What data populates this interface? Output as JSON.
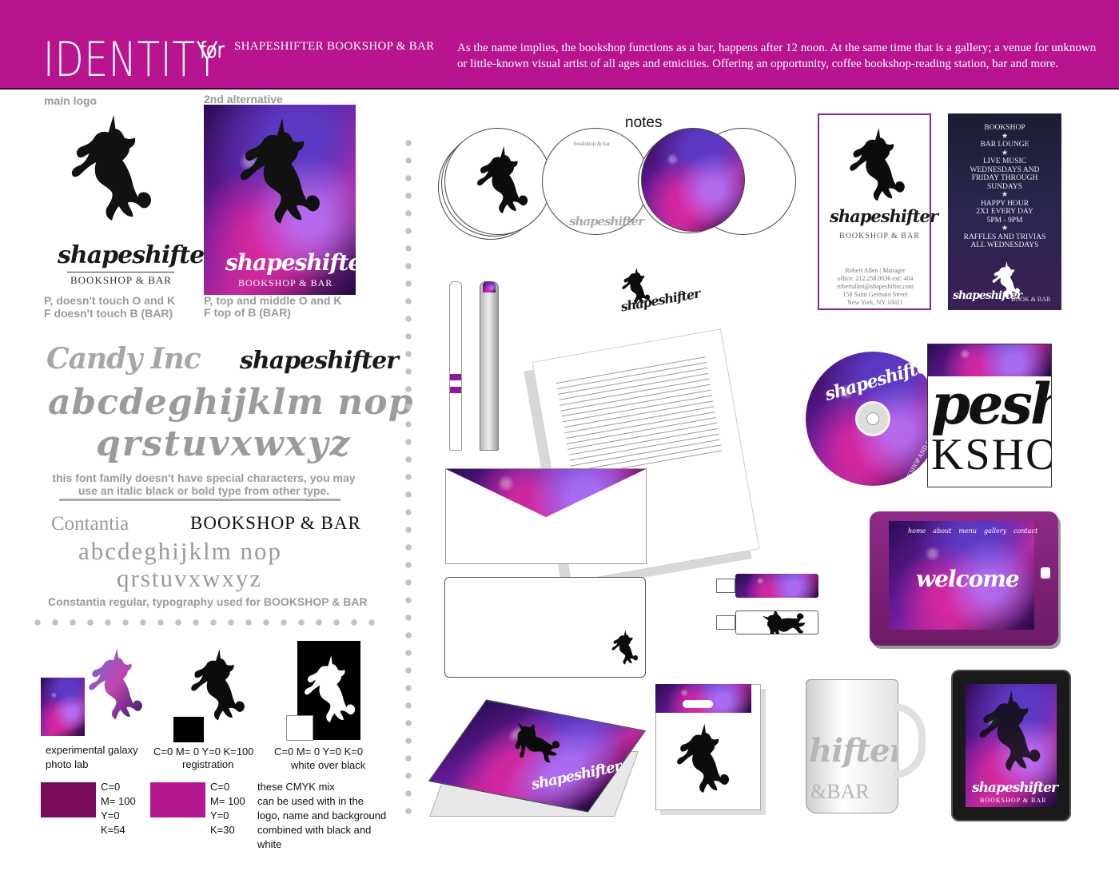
{
  "header": {
    "identity": "IDENTITY",
    "for": "for",
    "brand": "SHAPESHIFTER  BOOKSHOP & BAR",
    "description": "As the name implies, the bookshop functions as a bar, happens after 12 noon. At the same time that is a gallery; a venue for unknown or little-known visual artist of all ages and etnicities. Offering an opportunity, coffee bookshop-reading station, bar and more."
  },
  "logos": {
    "main_label": "main logo",
    "alt_label": "2nd alternative",
    "wordmark": "shapeshifter",
    "sub": "BOOKSHOP & BAR",
    "main_note_1": "P, doesn't touch O and K",
    "main_note_2": "F doesn't touch B (BAR)",
    "alt_note_1": "P, top and middle O and K",
    "alt_note_2": "F top of B (BAR)"
  },
  "fonts": {
    "candy_name": "Candy Inc",
    "candy_brand": "shapeshifter",
    "candy_alpha_1": "abcdeghijklm nop",
    "candy_alpha_2": "qrstuvxwxyz",
    "candy_note": "this font family doesn't have special characters, you may use an italic black or bold type from other type.",
    "constantia_name": "Contantia",
    "constantia_brand": "BOOKSHOP & BAR",
    "constantia_alpha_1": "abcdeghijklm nop",
    "constantia_alpha_2": "qrstuvxwxyz",
    "constantia_note": "Constantia regular, typography used for BOOKSHOP & BAR"
  },
  "colors": {
    "galaxy_label_1": "experimental galaxy",
    "galaxy_label_2": "photo lab",
    "reg_cmyk": "C=0   M= 0   Y=0   K=100",
    "reg_label": "registration",
    "white_cmyk": "C=0   M= 0   Y=0   K=0",
    "white_label": "white over black",
    "swatch1": [
      "C=0",
      "M= 100",
      "Y=0",
      "K=54"
    ],
    "swatch2": [
      "C=0",
      "M= 100",
      "Y=0",
      "K=30"
    ],
    "cmyk_note": [
      "these CMYK mix",
      "can be used with in the",
      "logo, name and background",
      "combined with black and",
      "white"
    ],
    "swatch1_hex": "#7a0c5e",
    "swatch2_hex": "#b3168f",
    "header_hex": "#b8148f"
  },
  "mockups": {
    "notes_label": "notes",
    "coaster_text": "bookshop & bar",
    "card_name": "Robert Allen  |  Manager",
    "card_office": "office: 212.258.0036 ext: 404",
    "card_email": "robertallen@shapeshifter.com",
    "card_address": "150 Saint Germain Street",
    "card_city": "New York, NY 10021",
    "flyer_lines": [
      "BOOKSHOP",
      "★",
      "BAR LOUNGE",
      "★",
      "LIVE MUSIC",
      "WEDNESDAYS AND",
      "FRIDAY THROUGH",
      "SUNDAYS",
      "★",
      "HAPPY HOUR",
      "2X1 EVERY DAY",
      "5PM - 9PM",
      "★",
      "RAFFLES AND TRIVIAS",
      "ALL WEDNESDAYS"
    ],
    "flyer_footer": "BOOK & BAR",
    "cd_text": "BOOKSHOP AND BAR",
    "box_big_1": "pesh",
    "box_big_2": "KSHO",
    "tablet_nav": [
      "home",
      "about",
      "menu",
      "gallery",
      "contact"
    ],
    "tablet_welcome": "welcome",
    "mug_1": "hifter",
    "mug_2": "&BAR"
  }
}
